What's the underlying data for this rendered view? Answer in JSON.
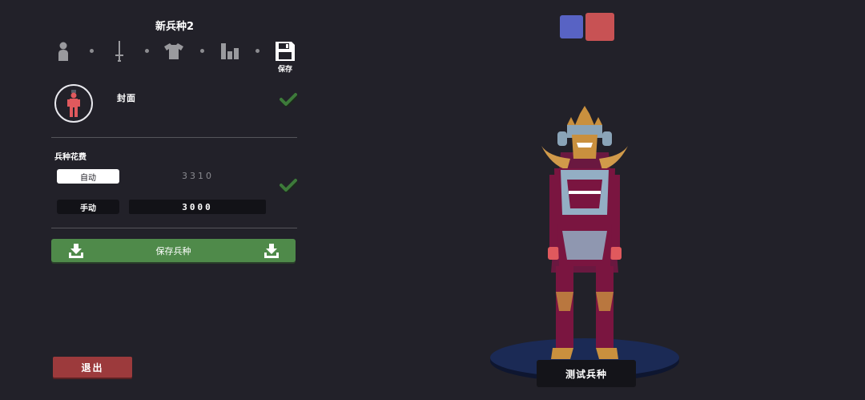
{
  "header": {
    "unit_name": "新兵种2",
    "save_label": "保存"
  },
  "tabs": [
    {
      "name": "body",
      "icon": "person-icon"
    },
    {
      "name": "weapon",
      "icon": "sword-icon"
    },
    {
      "name": "clothing",
      "icon": "shirt-icon"
    },
    {
      "name": "stats",
      "icon": "bar-chart-icon"
    },
    {
      "name": "save",
      "icon": "floppy-disk-icon"
    }
  ],
  "cover": {
    "label": "封面",
    "checked": true
  },
  "cost": {
    "label": "兵种花费",
    "auto_label": "自动",
    "auto_value": "3310",
    "manual_label": "手动",
    "manual_value": "3000",
    "checked": true
  },
  "save_unit_button": {
    "label": "保存兵种"
  },
  "exit_button": {
    "label": "退出"
  },
  "team_colors": {
    "blue": "#5863c4",
    "red": "#c85254"
  },
  "test_button": {
    "label": "测试兵种"
  },
  "colors": {
    "background": "#222129",
    "save_green": "#4f8a4a",
    "exit_red": "#9c3a3c",
    "check_green": "#3d7a3a"
  }
}
